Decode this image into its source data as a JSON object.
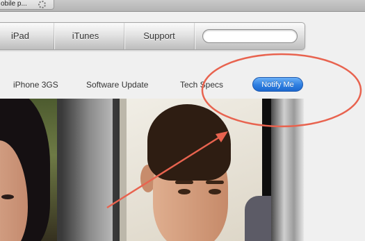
{
  "browser": {
    "tab_title": "obile p...",
    "loading_icon": "spinner-icon"
  },
  "global_nav": {
    "items": [
      "iPad",
      "iTunes",
      "Support"
    ],
    "search": {
      "placeholder": "",
      "value": ""
    }
  },
  "product_nav": {
    "items": [
      "iPhone 3GS",
      "Software Update",
      "Tech Specs"
    ],
    "notify_button": "Notify Me"
  },
  "hero": {
    "description": ""
  },
  "annotation": {
    "color": "#e8634f",
    "shapes": [
      "ellipse",
      "arrow"
    ]
  },
  "colors": {
    "notify_blue": "#2f7fe0",
    "nav_gray": "#d6d6d6"
  }
}
